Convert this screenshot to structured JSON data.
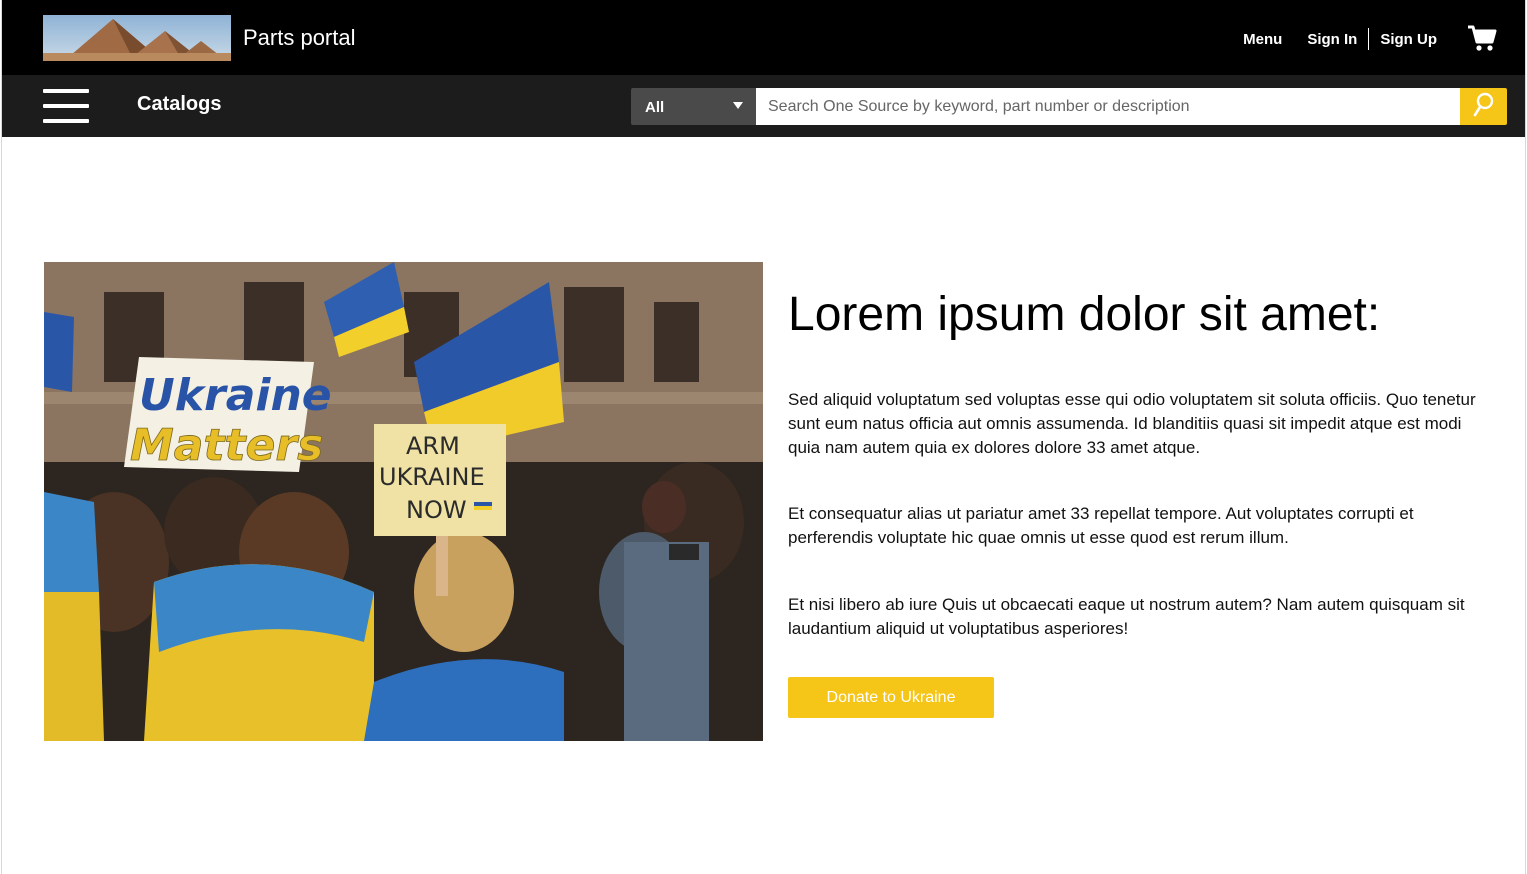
{
  "header": {
    "brand": "Parts portal",
    "menu_label": "Menu",
    "sign_in_label": "Sign In",
    "sign_up_label": "Sign Up"
  },
  "navbar": {
    "catalogs_label": "Catalogs",
    "search": {
      "category_selected": "All",
      "placeholder": "Search One Source by keyword, part number or description",
      "value": ""
    }
  },
  "hero": {
    "image_signs": [
      "Ukraine",
      "Matters",
      "ARM",
      "UKRAINE",
      "NOW"
    ],
    "headline": "Lorem ipsum dolor sit amet:",
    "paragraphs": [
      "Sed aliquid voluptatum sed voluptas esse qui odio voluptatem sit soluta officiis. Quo tenetur sunt eum natus officia aut omnis assumenda. Id blanditiis quasi sit impedit atque est modi quia nam autem quia ex dolores dolore 33 amet atque.",
      "Et consequatur alias ut pariatur amet 33 repellat tempore. Aut voluptates corrupti et perferendis voluptate hic quae omnis ut esse quod est rerum illum.",
      "Et nisi libero ab iure Quis ut obcaecati eaque ut nostrum autem? Nam autem quisquam sit laudantium aliquid ut voluptatibus asperiores!"
    ],
    "cta_label": "Donate to Ukraine"
  },
  "colors": {
    "topbar": "#000000",
    "navbar": "#1c1c1c",
    "accent": "#f5c518",
    "select_bg": "#4a4a4a"
  },
  "icons": {
    "logo": "pyramids-logo-icon",
    "cart": "shopping-cart-icon",
    "hamburger": "hamburger-menu-icon",
    "search": "search-icon",
    "caret": "caret-down-icon"
  }
}
